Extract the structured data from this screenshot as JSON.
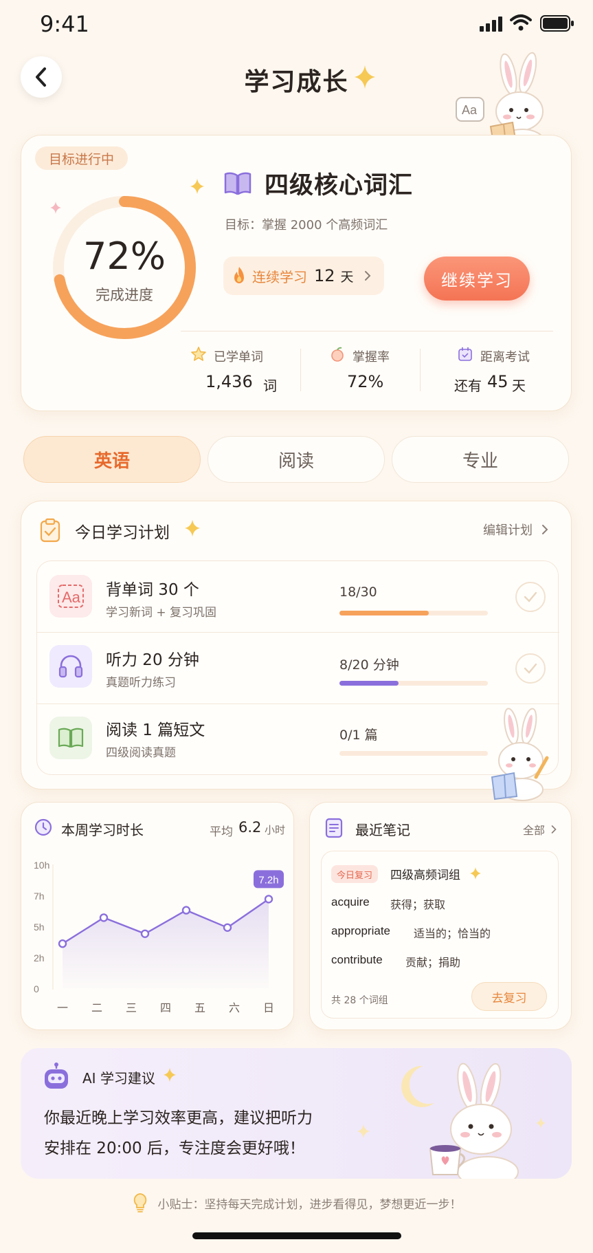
{
  "status": {
    "time": "9:41"
  },
  "header": {
    "title": "学习成长"
  },
  "goal": {
    "badge": "目标进行中",
    "progress_percent": "72%",
    "progress_value": 0.72,
    "progress_label": "完成进度",
    "book_title": "四级核心词汇",
    "subtitle": "目标：掌握 2000 个高频词汇",
    "streak_label": "连续学习",
    "streak_days": "12",
    "streak_unit": "天",
    "continue_label": "继续学习",
    "stats": [
      {
        "label": "已学单词",
        "value": "1,436",
        "unit": "词"
      },
      {
        "label": "掌握率",
        "value": "72%"
      },
      {
        "label": "距离考试",
        "prefix": "还有",
        "value": "45",
        "unit": "天"
      }
    ]
  },
  "tabs": [
    "英语",
    "阅读",
    "专业"
  ],
  "plan": {
    "title": "今日学习计划",
    "edit_label": "编辑计划",
    "items": [
      {
        "title": "背单词 30 个",
        "desc": "学习新词 + 复习巩固",
        "progress_text": "18/30",
        "progress": 0.6,
        "color": "#f6a25b"
      },
      {
        "title": "听力 20 分钟",
        "desc": "真题听力练习",
        "progress_text": "8/20 分钟",
        "progress": 0.4,
        "color": "#8a6fdc"
      },
      {
        "title": "阅读 1 篇短文",
        "desc": "四级阅读真题",
        "progress_text": "0/1 篇",
        "progress": 0,
        "color": "#f6a25b"
      }
    ]
  },
  "weekly": {
    "title": "本周学习时长",
    "avg_label": "平均",
    "avg_value": "6.2",
    "avg_unit": "小时",
    "tooltip": "7.2h"
  },
  "chart_data": {
    "type": "area",
    "categories": [
      "一",
      "二",
      "三",
      "四",
      "五",
      "六",
      "日"
    ],
    "values": [
      3.6,
      5.7,
      4.4,
      6.3,
      4.9,
      7.2,
      null
    ],
    "y_ticks": [
      "0",
      "2h",
      "5h",
      "7h",
      "10h"
    ],
    "ylim": [
      0,
      10
    ],
    "color": "#8a6fdc"
  },
  "notes": {
    "title": "最近笔记",
    "all_label": "全部",
    "tag": "今日复习",
    "group_title": "四级高频词组",
    "words": [
      {
        "en": "acquire",
        "cn": "获得；获取"
      },
      {
        "en": "appropriate",
        "cn": "适当的；恰当的"
      },
      {
        "en": "contribute",
        "cn": "贡献；捐助"
      }
    ],
    "count_text": "共 28 个词组",
    "review_label": "去复习"
  },
  "ai": {
    "title": "AI 学习建议",
    "line1": "你最近晚上学习效率更高，建议把听力",
    "line2": "安排在 20:00 后，专注度会更好哦！"
  },
  "tip": "小贴士：坚持每天完成计划，进步看得见，梦想更近一步！",
  "colors": {
    "accent": "#f47a55",
    "purple": "#8a6fdc",
    "orange": "#f6a25b",
    "bg": "#fdf7ef"
  }
}
